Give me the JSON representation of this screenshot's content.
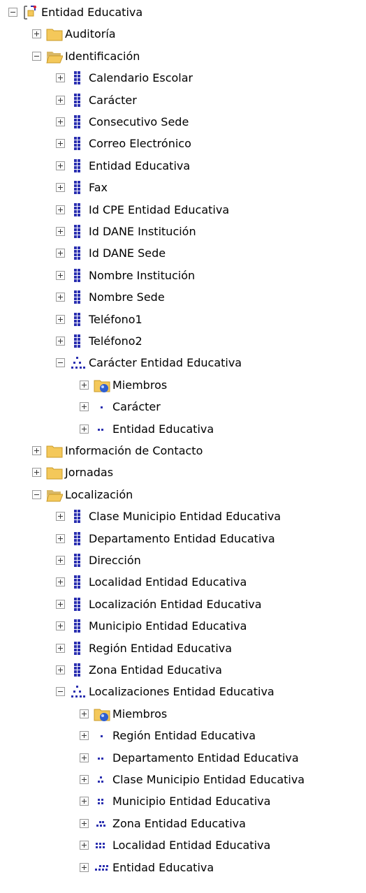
{
  "tree": [
    {
      "label": "Entidad Educativa",
      "icon": "dimension-icon",
      "expanded": true,
      "level": 0
    },
    {
      "label": "Auditoría",
      "icon": "folder-icon",
      "expanded": false,
      "level": 1
    },
    {
      "label": "Identificación",
      "icon": "folder-open-icon",
      "expanded": true,
      "level": 1
    },
    {
      "label": "Calendario Escolar",
      "icon": "attribute-icon",
      "expanded": false,
      "level": 2
    },
    {
      "label": "Carácter",
      "icon": "attribute-icon",
      "expanded": false,
      "level": 2
    },
    {
      "label": "Consecutivo Sede",
      "icon": "attribute-icon",
      "expanded": false,
      "level": 2
    },
    {
      "label": "Correo Electrónico",
      "icon": "attribute-icon",
      "expanded": false,
      "level": 2
    },
    {
      "label": "Entidad Educativa",
      "icon": "attribute-icon",
      "expanded": false,
      "level": 2
    },
    {
      "label": "Fax",
      "icon": "attribute-icon",
      "expanded": false,
      "level": 2
    },
    {
      "label": "Id CPE Entidad Educativa",
      "icon": "attribute-icon",
      "expanded": false,
      "level": 2
    },
    {
      "label": "Id DANE Institución",
      "icon": "attribute-icon",
      "expanded": false,
      "level": 2
    },
    {
      "label": "Id DANE Sede",
      "icon": "attribute-icon",
      "expanded": false,
      "level": 2
    },
    {
      "label": "Nombre Institución",
      "icon": "attribute-icon",
      "expanded": false,
      "level": 2
    },
    {
      "label": "Nombre Sede",
      "icon": "attribute-icon",
      "expanded": false,
      "level": 2
    },
    {
      "label": "Teléfono1",
      "icon": "attribute-icon",
      "expanded": false,
      "level": 2
    },
    {
      "label": "Teléfono2",
      "icon": "attribute-icon",
      "expanded": false,
      "level": 2
    },
    {
      "label": "Carácter Entidad Educativa",
      "icon": "hierarchy-icon",
      "expanded": true,
      "level": 2
    },
    {
      "label": "Miembros",
      "icon": "members-folder-icon",
      "expanded": false,
      "level": 3
    },
    {
      "label": "Carácter",
      "icon": "level-1-icon",
      "expanded": false,
      "level": 3
    },
    {
      "label": "Entidad Educativa",
      "icon": "level-2-icon",
      "expanded": false,
      "level": 3
    },
    {
      "label": "Información de Contacto",
      "icon": "folder-icon",
      "expanded": false,
      "level": 1
    },
    {
      "label": "Jornadas",
      "icon": "folder-icon",
      "expanded": false,
      "level": 1
    },
    {
      "label": "Localización",
      "icon": "folder-open-icon",
      "expanded": true,
      "level": 1
    },
    {
      "label": "Clase Municipio Entidad Educativa",
      "icon": "attribute-icon",
      "expanded": false,
      "level": 2
    },
    {
      "label": "Departamento Entidad Educativa",
      "icon": "attribute-icon",
      "expanded": false,
      "level": 2
    },
    {
      "label": "Dirección",
      "icon": "attribute-icon",
      "expanded": false,
      "level": 2
    },
    {
      "label": "Localidad Entidad Educativa",
      "icon": "attribute-icon",
      "expanded": false,
      "level": 2
    },
    {
      "label": "Localización Entidad Educativa",
      "icon": "attribute-icon",
      "expanded": false,
      "level": 2
    },
    {
      "label": "Municipio Entidad Educativa",
      "icon": "attribute-icon",
      "expanded": false,
      "level": 2
    },
    {
      "label": "Región Entidad Educativa",
      "icon": "attribute-icon",
      "expanded": false,
      "level": 2
    },
    {
      "label": "Zona Entidad Educativa",
      "icon": "attribute-icon",
      "expanded": false,
      "level": 2
    },
    {
      "label": "Localizaciones Entidad Educativa",
      "icon": "hierarchy-icon",
      "expanded": true,
      "level": 2
    },
    {
      "label": "Miembros",
      "icon": "members-folder-icon",
      "expanded": false,
      "level": 3
    },
    {
      "label": "Región Entidad Educativa",
      "icon": "level-1-icon",
      "expanded": false,
      "level": 3
    },
    {
      "label": "Departamento Entidad Educativa",
      "icon": "level-2-icon",
      "expanded": false,
      "level": 3
    },
    {
      "label": "Clase Municipio Entidad Educativa",
      "icon": "level-3-icon",
      "expanded": false,
      "level": 3
    },
    {
      "label": "Municipio Entidad Educativa",
      "icon": "level-4-icon",
      "expanded": false,
      "level": 3
    },
    {
      "label": "Zona Entidad Educativa",
      "icon": "level-5-icon",
      "expanded": false,
      "level": 3
    },
    {
      "label": "Localidad Entidad Educativa",
      "icon": "level-6-icon",
      "expanded": false,
      "level": 3
    },
    {
      "label": "Entidad Educativa",
      "icon": "level-7-icon",
      "expanded": false,
      "level": 3
    }
  ],
  "colors": {
    "folder": "#f4c85a",
    "folder_dark": "#c99a27",
    "attribute": "#2a2fb0",
    "hierarchy": "#2a2fb0",
    "members_ball": "#2f5fd0"
  }
}
